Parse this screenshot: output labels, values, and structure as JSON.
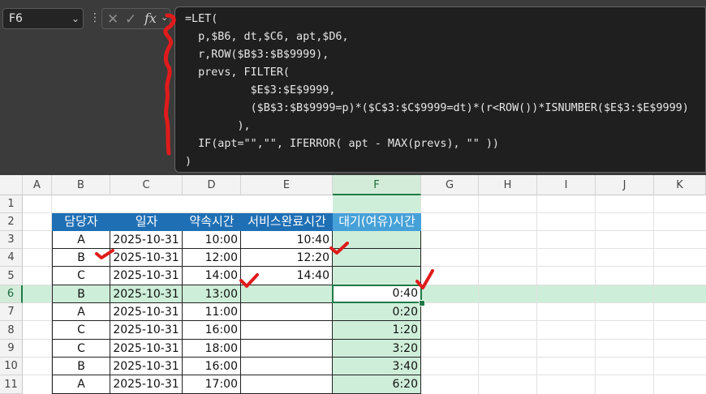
{
  "name_box": {
    "value": "F6"
  },
  "formula_bar": {
    "fx_label": "fx",
    "lines": [
      "=LET(",
      "  p,$B6, dt,$C6, apt,$D6,",
      "  r,ROW($B$3:$B$9999),",
      "  prevs, FILTER(",
      "          $E$3:$E$9999,",
      "          ($B$3:$B$9999=p)*($C$3:$C$9999=dt)*(r<ROW())*ISNUMBER($E$3:$E$9999)",
      "        ),",
      "  IF(apt=\"\",\"\", IFERROR( apt - MAX(prevs), \"\" ))",
      ")"
    ]
  },
  "columns": [
    "A",
    "B",
    "C",
    "D",
    "E",
    "F",
    "G",
    "H",
    "I",
    "J",
    "K"
  ],
  "rows": [
    "1",
    "2",
    "3",
    "4",
    "5",
    "6",
    "7",
    "8",
    "9",
    "10",
    "11"
  ],
  "table": {
    "headers": [
      "담당자",
      "일자",
      "약속시간",
      "서비스완료시간",
      "대기(여유)시간"
    ],
    "rows": [
      {
        "b": "A",
        "c": "2025-10-31",
        "d": "10:00",
        "e": "10:40",
        "f": ""
      },
      {
        "b": "B",
        "c": "2025-10-31",
        "d": "12:00",
        "e": "12:20",
        "f": ""
      },
      {
        "b": "C",
        "c": "2025-10-31",
        "d": "14:00",
        "e": "14:40",
        "f": ""
      },
      {
        "b": "B",
        "c": "2025-10-31",
        "d": "13:00",
        "e": "",
        "f": "0:40"
      },
      {
        "b": "A",
        "c": "2025-10-31",
        "d": "11:00",
        "e": "",
        "f": "0:20"
      },
      {
        "b": "C",
        "c": "2025-10-31",
        "d": "16:00",
        "e": "",
        "f": "1:20"
      },
      {
        "b": "C",
        "c": "2025-10-31",
        "d": "18:00",
        "e": "",
        "f": "3:20"
      },
      {
        "b": "B",
        "c": "2025-10-31",
        "d": "16:00",
        "e": "",
        "f": "3:40"
      },
      {
        "b": "A",
        "c": "2025-10-31",
        "d": "17:00",
        "e": "",
        "f": "6:20"
      }
    ]
  },
  "colors": {
    "header_blue": "#1f6fb5",
    "header_light_blue": "#46a1d8",
    "selection_green": "#1f7a46",
    "annotation_red": "#e01b1b"
  }
}
